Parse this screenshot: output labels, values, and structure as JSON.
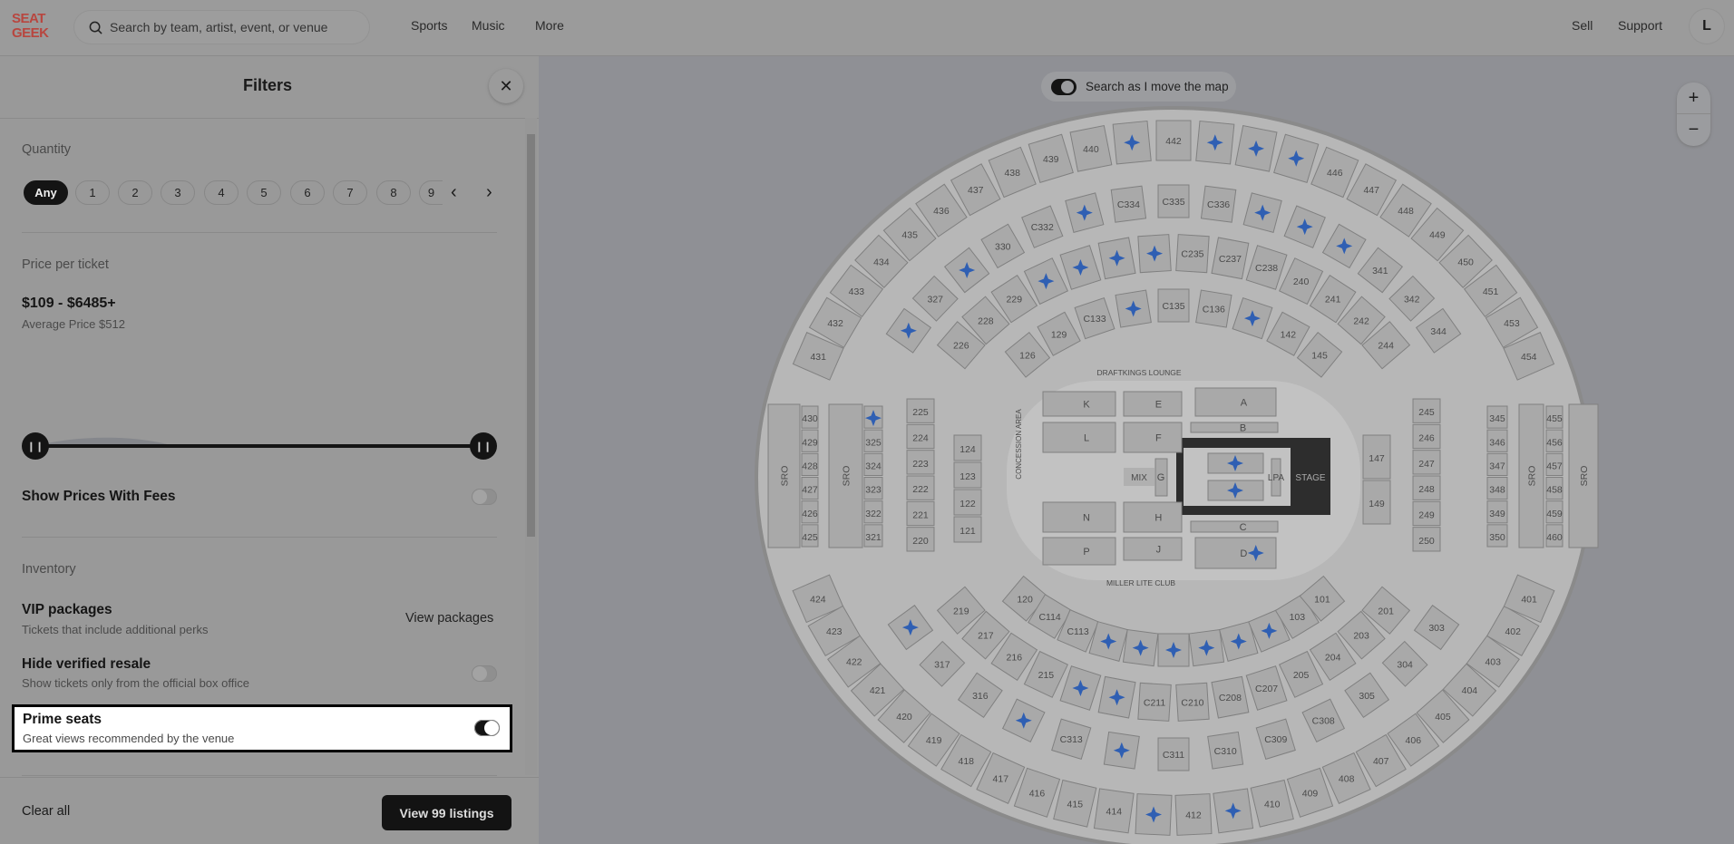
{
  "header": {
    "logo": "SEAT GEEK",
    "search_placeholder": "Search by team, artist, event, or venue",
    "nav": [
      "Sports",
      "Music",
      "More"
    ],
    "right": [
      "Sell",
      "Support"
    ],
    "avatar": "L"
  },
  "filters": {
    "title": "Filters",
    "quantity": {
      "label": "Quantity",
      "options": [
        "Any",
        "1",
        "2",
        "3",
        "4",
        "5",
        "6",
        "7",
        "8",
        "9"
      ],
      "selected": "Any"
    },
    "price": {
      "label": "Price per ticket",
      "range": "$109 - $6485+",
      "average": "Average Price $512",
      "slider_min_fraction": 0,
      "slider_max_fraction": 1
    },
    "show_fees": {
      "label": "Show Prices With Fees",
      "on": false
    },
    "inventory": {
      "label": "Inventory",
      "vip": {
        "title": "VIP packages",
        "sub": "Tickets that include additional perks",
        "link": "View packages"
      },
      "hide_resale": {
        "title": "Hide verified resale",
        "sub": "Show tickets only from the official box office",
        "on": false
      },
      "prime": {
        "title": "Prime seats",
        "sub": "Great views recommended by the venue",
        "on": true
      }
    },
    "clear": "Clear all",
    "view": "View 99 listings"
  },
  "map": {
    "search_toggle": "Search as I move the map",
    "search_toggle_on": true,
    "zoom_in": "+",
    "zoom_out": "−",
    "prime_color": "#2f5fb3",
    "ring4_top": [
      "431",
      "432",
      "433",
      "434",
      "435",
      "436",
      "437",
      "438",
      "439",
      "440",
      "★",
      "442",
      "★",
      "★",
      "★",
      "446",
      "447",
      "448",
      "449",
      "450",
      "451",
      "453",
      "454"
    ],
    "ring4_bottom": [
      "424",
      "423",
      "422",
      "421",
      "420",
      "419",
      "418",
      "417",
      "416",
      "415",
      "414",
      "★",
      "412",
      "★",
      "410",
      "409",
      "408",
      "407",
      "406",
      "405",
      "404",
      "403",
      "402",
      "401"
    ],
    "ring3_top": [
      "★",
      "327",
      "★",
      "330",
      "C332",
      "★",
      "C334",
      "C335",
      "C336",
      "★",
      "★",
      "★",
      "341",
      "342",
      "344"
    ],
    "ring3_bottom": [
      "★",
      "317",
      "316",
      "★",
      "C313",
      "★",
      "C311",
      "C310",
      "C309",
      "C308",
      "305",
      "304",
      "303"
    ],
    "ring2_top": [
      "226",
      "228",
      "229",
      "★",
      "★",
      "★",
      "★",
      "C235",
      "C237",
      "C238",
      "240",
      "241",
      "242",
      "244"
    ],
    "ring2_bottom": [
      "219",
      "217",
      "216",
      "215",
      "★",
      "★",
      "C211",
      "C210",
      "C208",
      "C207",
      "205",
      "204",
      "203",
      "201"
    ],
    "ring1_top": [
      "126",
      "129",
      "C133",
      "★",
      "C135",
      "C136",
      "★",
      "142",
      "145"
    ],
    "ring1_bottom": [
      "120",
      "C114",
      "C113",
      "★",
      "★",
      "★",
      "★",
      "★",
      "★",
      "103",
      "101"
    ],
    "left_cols": [
      [
        "430",
        "429",
        "428",
        "427",
        "426",
        "425"
      ],
      [
        "★",
        "325",
        "324",
        "323",
        "322",
        "321"
      ],
      [
        "225",
        "224",
        "223",
        "222",
        "221",
        "220"
      ],
      [
        "124",
        "123",
        "122",
        "121"
      ]
    ],
    "right_cols": [
      [
        "147",
        "149"
      ],
      [
        "245",
        "246",
        "247",
        "248",
        "249",
        "250"
      ],
      [
        "345",
        "346",
        "347",
        "348",
        "349",
        "350"
      ],
      [
        "455",
        "456",
        "457",
        "458",
        "459",
        "460"
      ]
    ],
    "sro": "SRO",
    "floor": [
      "K",
      "E",
      "A",
      "L",
      "F",
      "B",
      "MIX",
      "G",
      "N",
      "H",
      "C",
      "P",
      "J",
      "D",
      "LPA",
      "STAGE"
    ],
    "lounges": [
      "DRAFTKINGS LOUNGE",
      "MILLER LITE CLUB",
      "CONCESSION AREA"
    ]
  }
}
